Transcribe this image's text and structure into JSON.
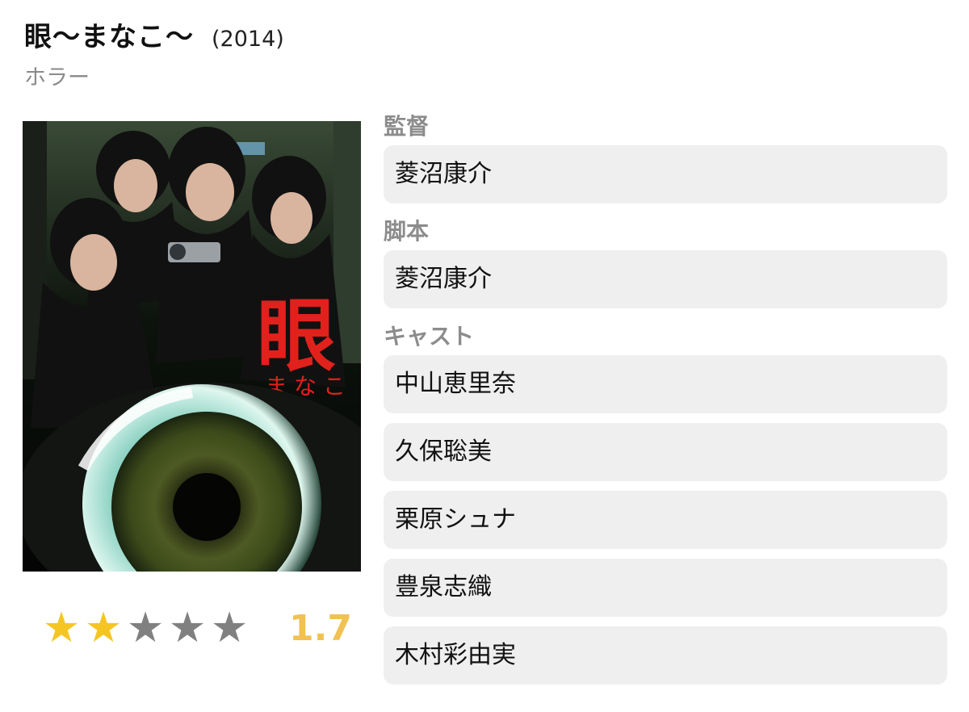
{
  "movie": {
    "title": "眼〜まなこ〜",
    "year": "(2014)",
    "genre": "ホラー",
    "poster": {
      "title_kanji": "眼",
      "title_kana": "まなこ"
    },
    "rating": {
      "stars_filled": 2,
      "stars_total": 5,
      "score": "1.7"
    }
  },
  "credits": {
    "director": {
      "label": "監督",
      "names": [
        "菱沼康介"
      ]
    },
    "writer": {
      "label": "脚本",
      "names": [
        "菱沼康介"
      ]
    },
    "cast": {
      "label": "キャスト",
      "names": [
        "中山恵里奈",
        "久保聡美",
        "栗原シュナ",
        "豊泉志織",
        "木村彩由実"
      ]
    }
  },
  "colors": {
    "star_on": "#f5c623",
    "star_off": "#808080",
    "score": "#f2c153",
    "pill_bg": "#efefef",
    "label": "#8c8c8c"
  }
}
